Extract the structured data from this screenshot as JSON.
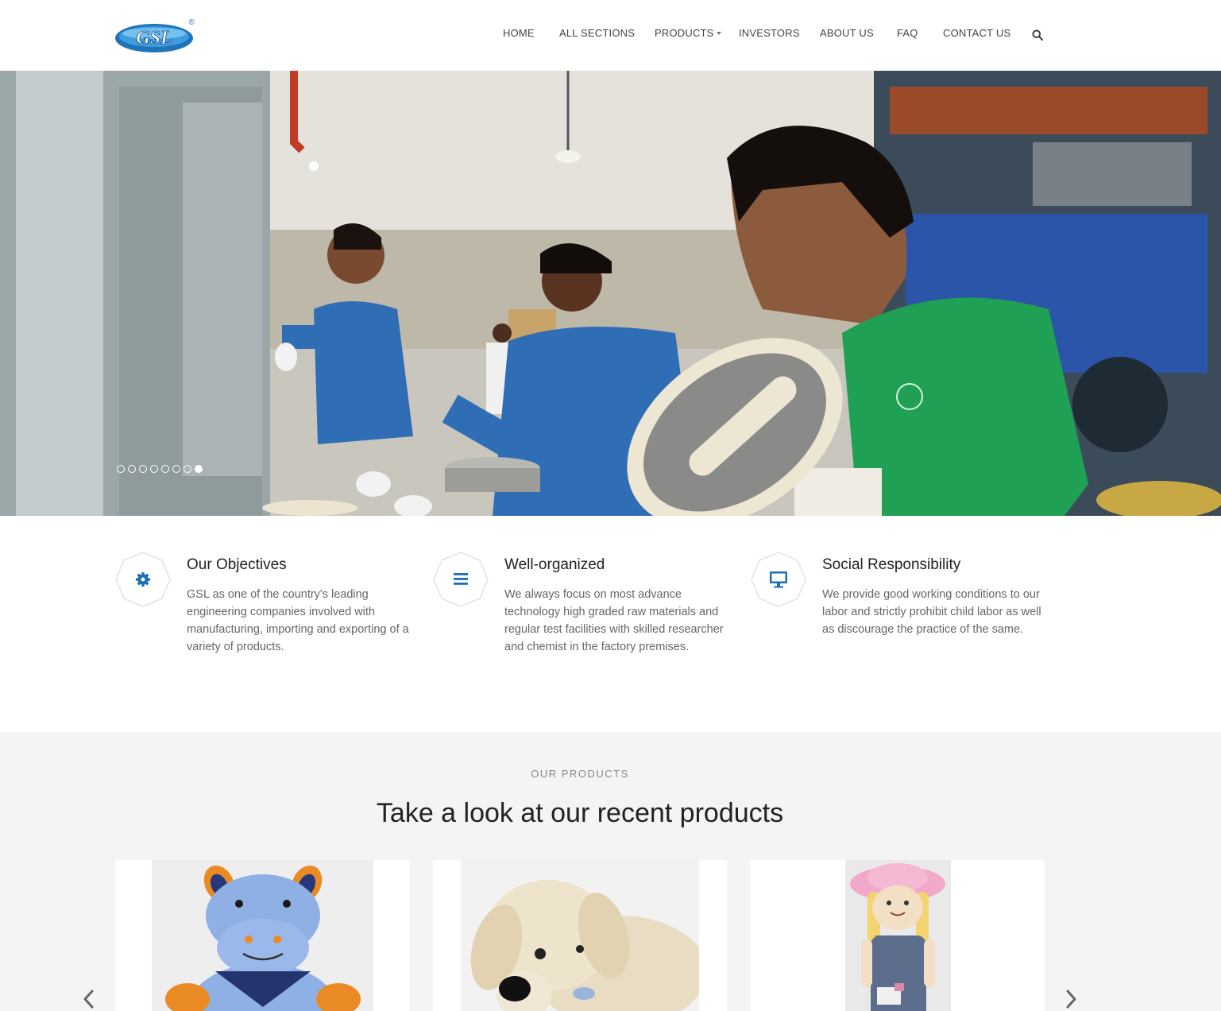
{
  "header": {
    "logo_text": "GSL",
    "logo_mark": "®",
    "nav": [
      {
        "label": "HOME"
      },
      {
        "label": "ALL SECTIONS"
      },
      {
        "label": "PRODUCTS"
      },
      {
        "label": "INVESTORS"
      },
      {
        "label": "ABOUT US"
      },
      {
        "label": "FAQ"
      },
      {
        "label": "CONTACT US"
      }
    ],
    "search_icon": "search-icon"
  },
  "hero": {
    "slide_count": 8,
    "active_slide": 8
  },
  "features": [
    {
      "icon": "gear-icon",
      "title": "Our Objectives",
      "text": "GSL as one of the country's leading engineering companies involved with manufacturing, importing and exporting of a variety of products."
    },
    {
      "icon": "list-icon",
      "title": "Well-organized",
      "text": "We always focus on most advance technology high graded raw materials and regular test facilities with skilled researcher and chemist in the factory premises."
    },
    {
      "icon": "monitor-icon",
      "title": "Social Responsibility",
      "text": "We provide good working conditions to our labor and strictly prohibit child labor as well as discourage the practice of the same."
    }
  ],
  "products": {
    "eyebrow": "OUR PRODUCTS",
    "heading": "Take a look at our recent products",
    "prev_icon": "chevron-left-icon",
    "next_icon": "chevron-right-icon"
  },
  "colors": {
    "accent": "#1a6fb5",
    "nav_text": "#444444",
    "section_bg": "#f4f4f4"
  }
}
